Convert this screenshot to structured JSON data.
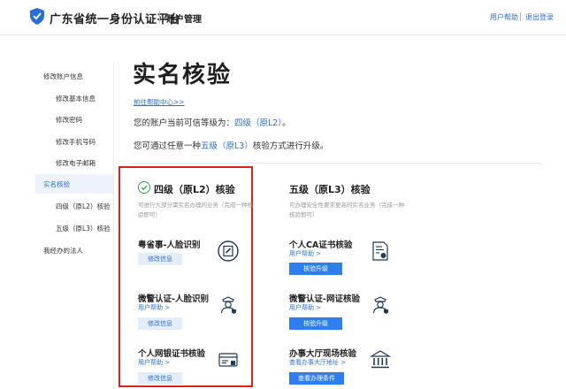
{
  "header": {
    "site_title": "广东省统一身份认证平台",
    "subtitle": "账户管理",
    "help_link": "用户帮助",
    "logout_link": "退出登录"
  },
  "sidebar": {
    "items": [
      {
        "label": "修改账户信息"
      },
      {
        "label": "修改基本信息"
      },
      {
        "label": "修改密码"
      },
      {
        "label": "修改手机号码"
      },
      {
        "label": "修改电子邮箱"
      },
      {
        "label": "实名核验",
        "active": true
      },
      {
        "label": "四级（原L2）核验"
      },
      {
        "label": "五级（原L3）核验"
      },
      {
        "label": "我经办的法人"
      }
    ]
  },
  "main": {
    "title": "实名核验",
    "help_link": "前往帮助中心>>",
    "current_level": {
      "prefix": "您的账户当前可信等级为：",
      "level": "四级（原L2）",
      "suffix": "。"
    },
    "upgrade_hint": {
      "prefix": "您可通过任意一种",
      "level": "五级（原L3）",
      "suffix": "核验方式进行升级。"
    },
    "level4": {
      "title": "四级（原L2）核验",
      "desc": "可进行大部分需实名办理的业务（完成一种核验即可）",
      "methods": [
        {
          "title": "粤省事-人脸识别",
          "link": "",
          "button": "修改信息",
          "icon": "face-id-icon"
        },
        {
          "title": "微警认证-人脸识别",
          "link": "用户帮助 >",
          "button": "修改信息",
          "icon": "police-officer-icon"
        },
        {
          "title": "个人网银证书核验",
          "link": "用户帮助 >",
          "button": "修改信息",
          "icon": "bank-card-icon"
        }
      ]
    },
    "level5": {
      "title": "五级（原L3）核验",
      "desc": "可办理安全性要求更高的实名业务（完成一种核验即可）",
      "methods": [
        {
          "title": "个人CA证书核验",
          "link": "用户帮助 >",
          "button": "核验升级",
          "icon": "certificate-icon"
        },
        {
          "title": "微警认证-网证核验",
          "link": "用户帮助 >",
          "button": "核验升级",
          "icon": "police-officer-icon"
        },
        {
          "title": "办事大厅现场核验",
          "link": "查看办事大厅地址 >",
          "button": "查看办理条件",
          "icon": "government-hall-icon"
        }
      ]
    }
  },
  "colors": {
    "accent": "#2a6fd6",
    "button": "#2d7ff0",
    "highlight": "#e02020",
    "check": "#2aa44f"
  }
}
